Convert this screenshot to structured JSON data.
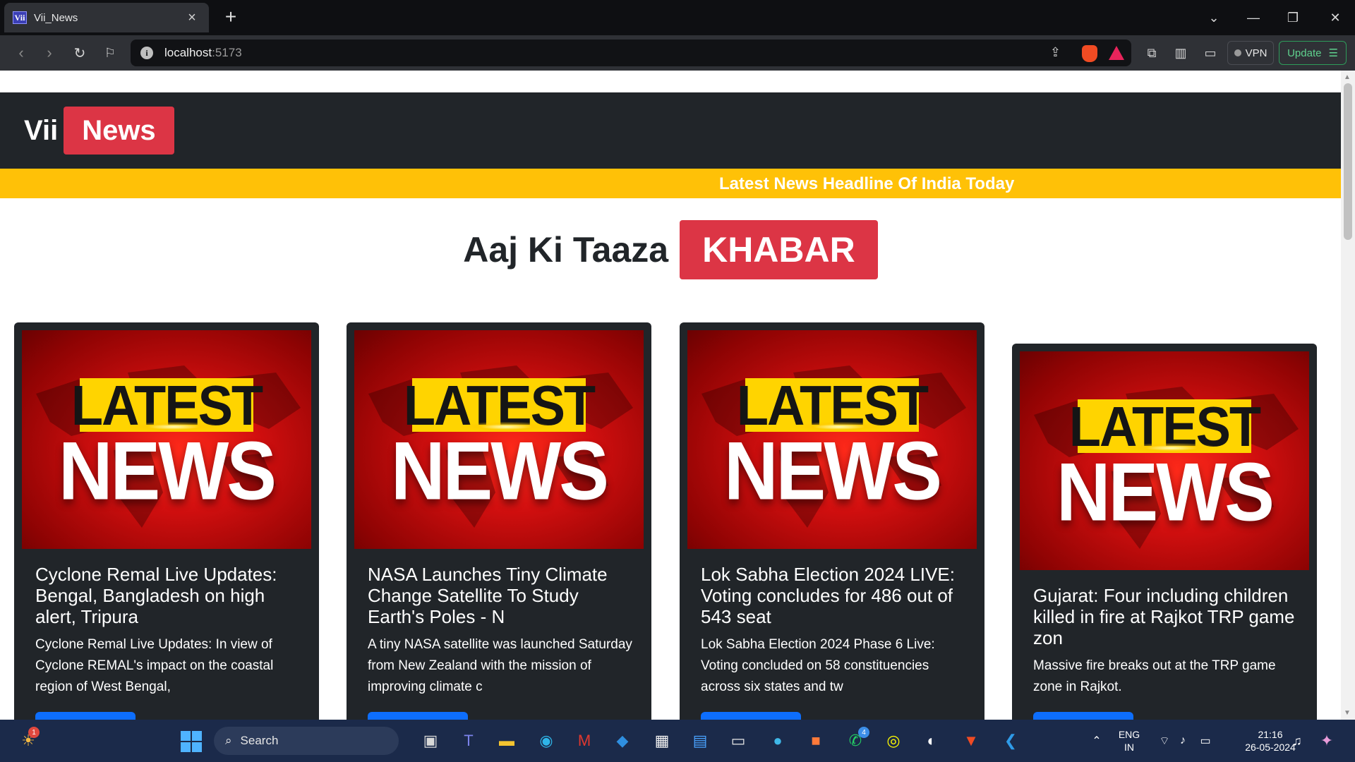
{
  "browser": {
    "tab_title": "Vii_News",
    "tab_favicon": "Vii",
    "url_host": "localhost",
    "url_port": ":5173",
    "vpn_label": "VPN",
    "update_label": "Update"
  },
  "site": {
    "brand_part1": "Vii",
    "brand_part2": "News",
    "marquee": "Latest News Headline Of India Today",
    "heading": "Aaj Ki Taaza",
    "heading_badge": "KHABAR"
  },
  "image_text": {
    "top": "LATEST",
    "bottom": "NEWS"
  },
  "cards": [
    {
      "title": "Cyclone Remal Live Updates: Bengal, Bangladesh on high alert, Tripura",
      "description": "Cyclone Remal Live Updates: In view of Cyclone REMAL's impact on the coastal region of West Bengal,"
    },
    {
      "title": "NASA Launches Tiny Climate Change Satellite To Study Earth's Poles - N",
      "description": "A tiny NASA satellite was launched Saturday from New Zealand with the mission of improving climate c"
    },
    {
      "title": "Lok Sabha Election 2024 LIVE: Voting concludes for 486 out of 543 seat",
      "description": "Lok Sabha Election 2024 Phase 6 Live: Voting concluded on 58 constituencies across six states and tw"
    },
    {
      "title": "Gujarat: Four including children killed in fire at Rajkot TRP game zon",
      "description": "Massive fire breaks out at the TRP game zone in Rajkot."
    }
  ],
  "taskbar": {
    "search_label": "Search",
    "weather_badge": "1",
    "whatsapp_badge": "4",
    "language_line1": "ENG",
    "language_line2": "IN",
    "time": "21:16",
    "date": "26-05-2024"
  },
  "colors": {
    "navbar": "#212529",
    "brand_red": "#dc3545",
    "marquee_yellow": "#ffc107",
    "button_blue": "#0d6efd"
  }
}
